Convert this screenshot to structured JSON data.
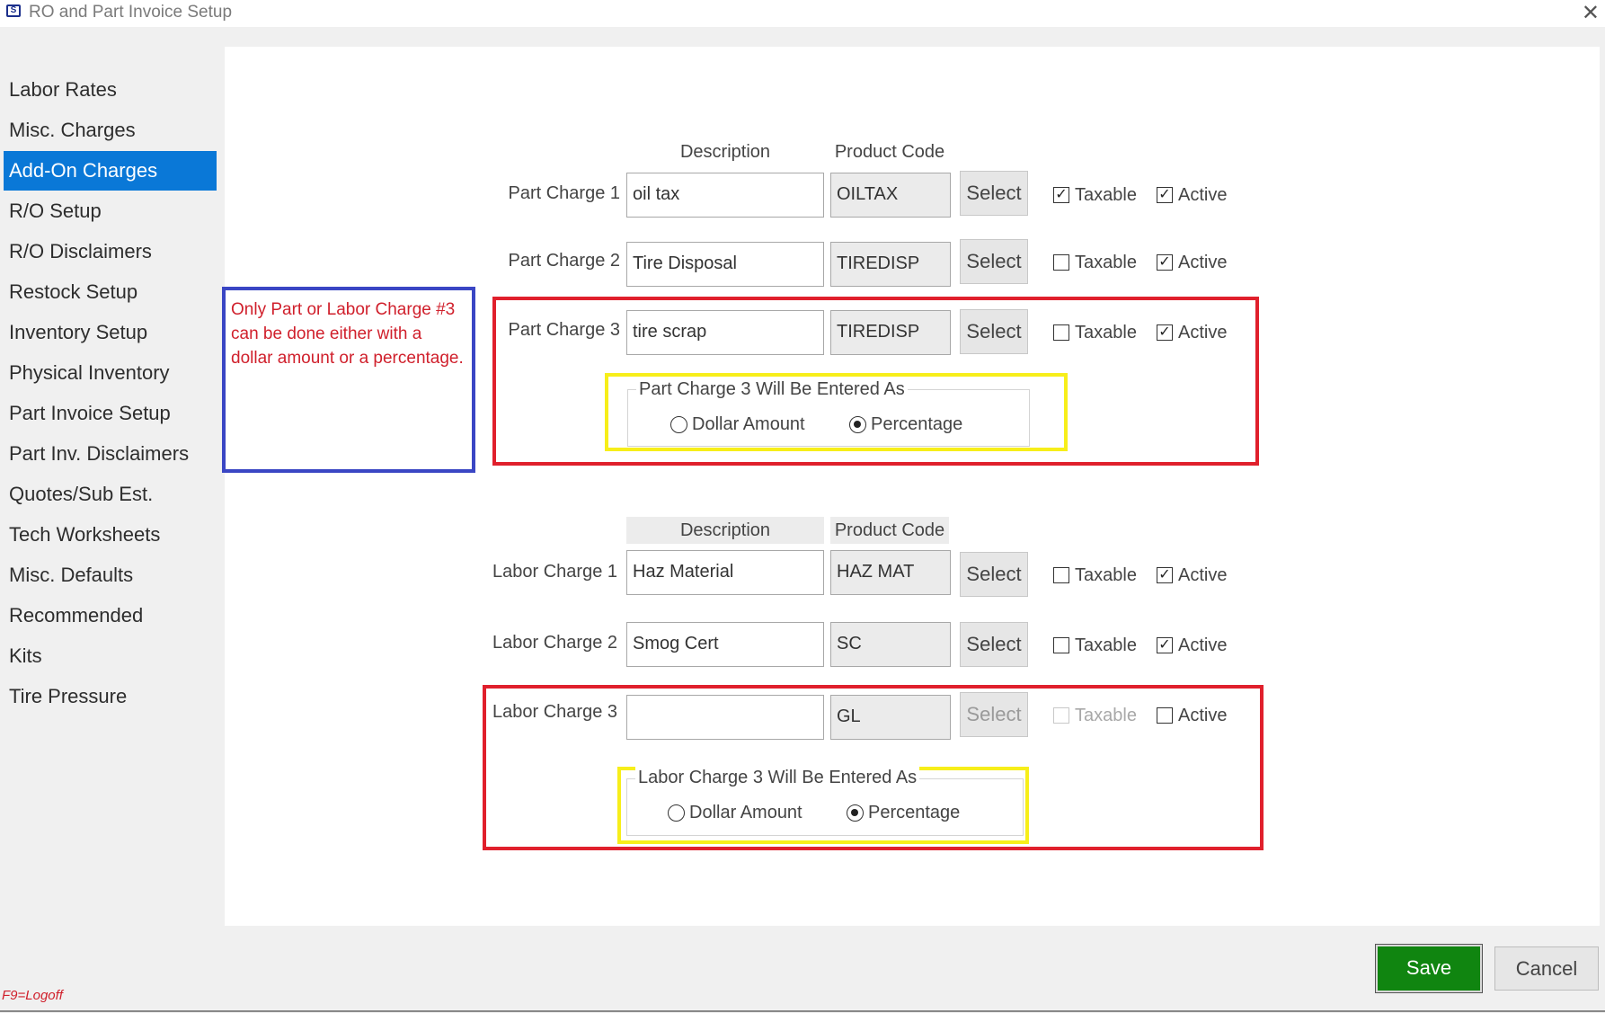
{
  "window": {
    "title": "RO and Part Invoice Setup",
    "close_glyph": "✕",
    "app_icon_glyph": "S"
  },
  "sidebar": {
    "items": [
      {
        "label": "Labor Rates"
      },
      {
        "label": "Misc. Charges"
      },
      {
        "label": "Add-On Charges",
        "active": true
      },
      {
        "label": "R/O Setup"
      },
      {
        "label": "R/O Disclaimers"
      },
      {
        "label": "Restock Setup"
      },
      {
        "label": "Inventory Setup"
      },
      {
        "label": "Physical Inventory"
      },
      {
        "label": "Part Invoice Setup"
      },
      {
        "label": "Part Inv. Disclaimers"
      },
      {
        "label": "Quotes/Sub Est."
      },
      {
        "label": "Tech Worksheets"
      },
      {
        "label": "Misc. Defaults"
      },
      {
        "label": "Recommended"
      },
      {
        "label": "Kits"
      },
      {
        "label": "Tire Pressure"
      }
    ]
  },
  "annotation": {
    "note": "Only Part or Labor Charge #3 can be done either with a dollar amount or a percentage."
  },
  "part_charges": {
    "headers": {
      "description": "Description",
      "product_code": "Product Code"
    },
    "rows": [
      {
        "label": "Part Charge 1",
        "description": "oil tax",
        "code": "OILTAX",
        "select": "Select",
        "taxable_label": "Taxable",
        "taxable": true,
        "active_label": "Active",
        "active": true
      },
      {
        "label": "Part Charge 2",
        "description": "Tire Disposal",
        "code": "TIREDISP",
        "select": "Select",
        "taxable_label": "Taxable",
        "taxable": false,
        "active_label": "Active",
        "active": true
      },
      {
        "label": "Part Charge 3",
        "description": "tire scrap",
        "code": "TIREDISP",
        "select": "Select",
        "taxable_label": "Taxable",
        "taxable": false,
        "active_label": "Active",
        "active": true
      }
    ],
    "entry_group": {
      "legend": "Part Charge 3 Will Be Entered As",
      "options": [
        "Dollar Amount",
        "Percentage"
      ],
      "selected": "Percentage"
    }
  },
  "labor_charges": {
    "headers": {
      "description": "Description",
      "product_code": "Product Code"
    },
    "rows": [
      {
        "label": "Labor Charge 1",
        "description": "Haz Material",
        "code": "HAZ MAT",
        "select": "Select",
        "taxable_label": "Taxable",
        "taxable": false,
        "active_label": "Active",
        "active": true
      },
      {
        "label": "Labor Charge 2",
        "description": "Smog Cert",
        "code": "SC",
        "select": "Select",
        "taxable_label": "Taxable",
        "taxable": false,
        "active_label": "Active",
        "active": true
      },
      {
        "label": "Labor Charge 3",
        "description": "",
        "code": "GL",
        "select": "Select",
        "taxable_label": "Taxable",
        "taxable": false,
        "active_label": "Active",
        "active": false
      }
    ],
    "entry_group": {
      "legend": "Labor Charge 3 Will Be Entered As",
      "options": [
        "Dollar Amount",
        "Percentage"
      ],
      "selected": "Percentage"
    }
  },
  "footer": {
    "save": "Save",
    "cancel": "Cancel",
    "logoff_hint": "F9=Logoff"
  },
  "colors": {
    "accent": "#0a78d7",
    "save_green": "#108510",
    "highlight_red": "#e0202c",
    "highlight_yellow": "#f7ee1a",
    "note_blue": "#3a46c4",
    "note_text": "#d0202c"
  }
}
